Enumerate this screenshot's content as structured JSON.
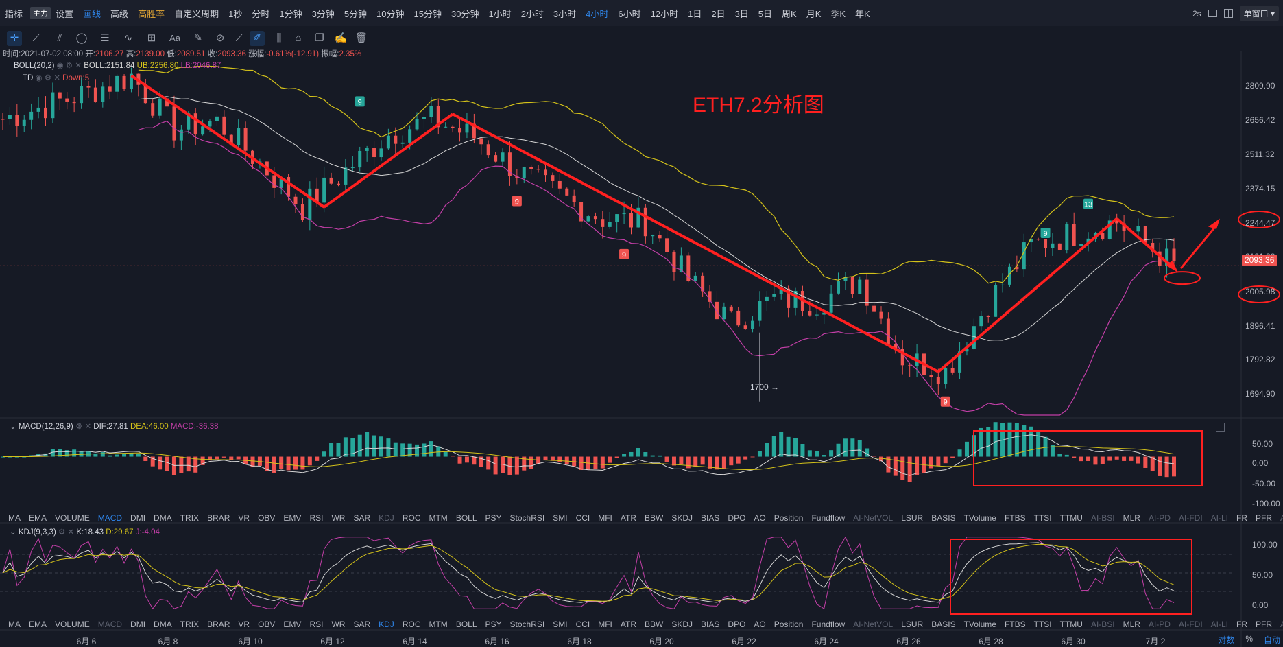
{
  "topbar": {
    "items": [
      "指标",
      "设置",
      "画线",
      "高级",
      "高胜率",
      "自定义周期",
      "1秒",
      "分时",
      "1分钟",
      "3分钟",
      "5分钟",
      "10分钟",
      "15分钟",
      "30分钟",
      "1小时",
      "2小时",
      "3小时",
      "4小时",
      "6小时",
      "12小时",
      "1日",
      "2日",
      "3日",
      "5日",
      "周K",
      "月K",
      "季K",
      "年K"
    ],
    "tag": "主力",
    "active": "4小时",
    "right_interval": "2s",
    "window_mode": "单窗口"
  },
  "ohlc_line": {
    "time": "时间:2021-07-02 08:00",
    "open_label": "开:",
    "open": "2106.27",
    "high_label": "高:",
    "high": "2139.00",
    "low_label": "低:",
    "low": "2089.51",
    "close_label": "收:",
    "close": "2093.36",
    "change_label": "涨幅:",
    "change": "-0.61%(-12.91)",
    "amp_label": "振幅:",
    "amp": "2.35%"
  },
  "boll_line": {
    "name": "BOLL(20,2)",
    "boll": "BOLL:2151.84",
    "ub": "UB:2256.80",
    "lb": "LB:2046.87"
  },
  "td_line": {
    "name": "TD",
    "down": "Down:5"
  },
  "annotation_title": "ETH7.2分析图",
  "low_marker": "1700 →",
  "macd_line": {
    "name": "MACD(12,26,9)",
    "dif": "DIF:27.81",
    "dea": "DEA:46.00",
    "macd": "MACD:-36.38"
  },
  "kdj_line": {
    "name": "KDJ(9,3,3)",
    "k": "K:18.43",
    "d": "D:29.67",
    "j": "J:-4.04"
  },
  "indicator_tabs": [
    "MA",
    "EMA",
    "VOLUME",
    "MACD",
    "DMI",
    "DMA",
    "TRIX",
    "BRAR",
    "VR",
    "OBV",
    "EMV",
    "RSI",
    "WR",
    "SAR",
    "KDJ",
    "ROC",
    "MTM",
    "BOLL",
    "PSY",
    "StochRSI",
    "SMI",
    "CCI",
    "MFI",
    "ATR",
    "BBW",
    "SKDJ",
    "BIAS",
    "DPO",
    "AO",
    "Position",
    "Fundflow",
    "AI-NetVOL",
    "LSUR",
    "BASIS",
    "TVolume",
    "FTBS",
    "TTSI",
    "TTMU",
    "AI-BSI",
    "MLR",
    "AI-PD",
    "AI-FDI",
    "AI-LI",
    "FR",
    "PFR",
    "AI-BST"
  ],
  "price_axis": [
    "2809.90",
    "2656.42",
    "2511.32",
    "2374.15",
    "2244.47",
    "2121.88",
    "2005.98",
    "1896.41",
    "1792.82",
    "1694.90"
  ],
  "current_price": "2093.36",
  "macd_axis": [
    "50.00",
    "0.00",
    "-50.00",
    "-100.00"
  ],
  "kdj_axis": [
    "100.00",
    "50.00",
    "0.00"
  ],
  "x_axis": [
    "6月 6",
    "6月 8",
    "6月 10",
    "6月 12",
    "6月 14",
    "6月 16",
    "6月 18",
    "6月 20",
    "6月 22",
    "6月 24",
    "6月 26",
    "6月 28",
    "6月 30",
    "7月 2"
  ],
  "bottom_right": [
    "对数",
    "%",
    "自动"
  ],
  "td_markers": [
    "9",
    "9",
    "9",
    "9",
    "9",
    "13"
  ],
  "colors": {
    "up": "#26a69a",
    "down": "#ef5350",
    "accent": "#2f86eb",
    "annotation": "#ff2020",
    "boll_mid": "#d6d6d6",
    "boll_ub": "#d4c21a",
    "boll_lb": "#c43fa8"
  },
  "chart_data": {
    "type": "candlestick",
    "timeframe": "4小时",
    "x_range": [
      "2021-06-05",
      "2021-07-02"
    ],
    "y_axis_scale": "log",
    "ylim": [
      1680,
      2860
    ],
    "close_path": [
      {
        "x": "2021-06-05",
        "y": 2620
      },
      {
        "x": "2021-06-07",
        "y": 2730
      },
      {
        "x": "2021-06-08",
        "y": 2800
      },
      {
        "x": "2021-06-09",
        "y": 2580
      },
      {
        "x": "2021-06-10",
        "y": 2610
      },
      {
        "x": "2021-06-11",
        "y": 2450
      },
      {
        "x": "2021-06-12",
        "y": 2290
      },
      {
        "x": "2021-06-14",
        "y": 2560
      },
      {
        "x": "2021-06-15",
        "y": 2620
      },
      {
        "x": "2021-06-16",
        "y": 2550
      },
      {
        "x": "2021-06-17",
        "y": 2420
      },
      {
        "x": "2021-06-18",
        "y": 2330
      },
      {
        "x": "2021-06-19",
        "y": 2250
      },
      {
        "x": "2021-06-20",
        "y": 2240
      },
      {
        "x": "2021-06-21",
        "y": 2050
      },
      {
        "x": "2021-06-22",
        "y": 1920
      },
      {
        "x": "2021-06-23",
        "y": 1990
      },
      {
        "x": "2021-06-24",
        "y": 1980
      },
      {
        "x": "2021-06-25",
        "y": 2050
      },
      {
        "x": "2021-06-26",
        "y": 1820
      },
      {
        "x": "2021-06-27",
        "y": 1780
      },
      {
        "x": "2021-06-28",
        "y": 1980
      },
      {
        "x": "2021-06-29",
        "y": 2160
      },
      {
        "x": "2021-06-30",
        "y": 2200
      },
      {
        "x": "2021-07-01",
        "y": 2240
      },
      {
        "x": "2021-07-02",
        "y": 2093
      }
    ],
    "last_bar": {
      "open": 2106.27,
      "high": 2139.0,
      "low": 2089.51,
      "close": 2093.36
    },
    "boll": {
      "mid": 2151.84,
      "upper": 2256.8,
      "lower": 2046.87
    },
    "low_annotation": 1700,
    "marked_prices": [
      2244.47,
      2005.98
    ],
    "macd": {
      "dif": 27.81,
      "dea": 46.0,
      "hist": -36.38,
      "ylim": [
        -110,
        70
      ]
    },
    "kdj": {
      "k": 18.43,
      "d": 29.67,
      "j": -4.04,
      "ylim": [
        -10,
        110
      ]
    }
  }
}
